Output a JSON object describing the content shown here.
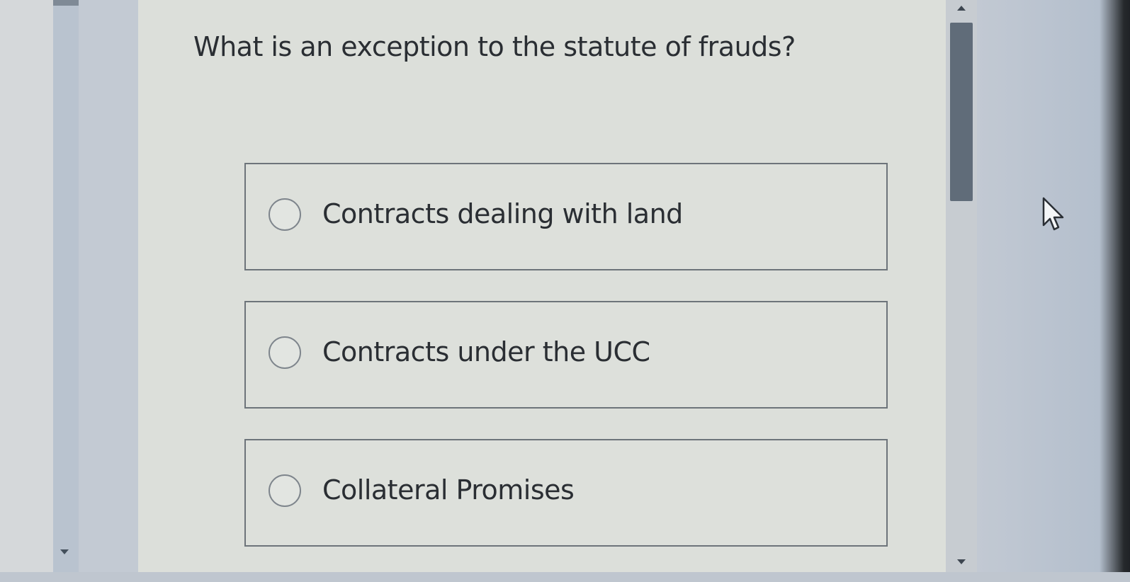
{
  "quiz": {
    "question": "What is an exception to the statute of frauds?",
    "options": [
      {
        "label": "Contracts dealing with land",
        "selected": false
      },
      {
        "label": "Contracts under the UCC",
        "selected": false
      },
      {
        "label": "Collateral Promises",
        "selected": false
      }
    ]
  },
  "icons": {
    "cursor": "mouse-pointer-icon",
    "scroll_up": "chevron-up-icon",
    "scroll_down": "chevron-down-icon"
  },
  "scroll": {
    "position_fraction": 0.0
  },
  "colors": {
    "text": "#2a2e33",
    "content_bg": "#dcdfda",
    "option_border": "#6d747a",
    "scroll_thumb": "#606c79"
  }
}
